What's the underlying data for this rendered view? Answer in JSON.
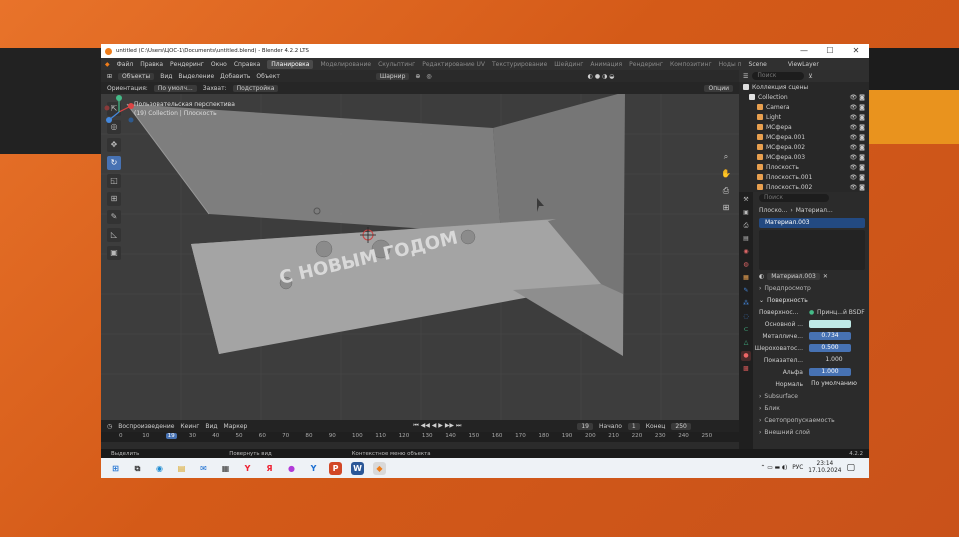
{
  "window": {
    "title": "untitled (C:\\Users\\ЦОС-1\\Documents\\untitled.blend) - Blender 4.2.2 LTS",
    "min": "—",
    "max": "☐",
    "close": "✕"
  },
  "menu": {
    "items": [
      "Файл",
      "Правка",
      "Рендеринг",
      "Окно",
      "Справка"
    ],
    "workspaces": [
      "Планировка",
      "Моделирование",
      "Скульптинг",
      "Редактирование UV",
      "Текстурирование",
      "Шейдинг",
      "Анимация",
      "Рендеринг",
      "Композитинг",
      "Ноды п"
    ],
    "scene": "Scene",
    "view_layer": "ViewLayer"
  },
  "header": {
    "mode": "Объекты",
    "view": "Вид",
    "select": "Выделение",
    "add": "Добавить",
    "object": "Объект",
    "shading": "Шарнир",
    "options": "Опции"
  },
  "header2": {
    "orientation_label": "Ориентация:",
    "orientation": "По умолч...",
    "drag_label": "Захват:",
    "snap": "Подстройка"
  },
  "viewport": {
    "perspective": "Пользовательская перспектива",
    "collection": "(19) Collection | Плоскость",
    "text3d": "С НОВЫМ ГОДОМ"
  },
  "timeline": {
    "playback": "Воспроизведение",
    "keying": "Кеинг",
    "view": "Вид",
    "marker": "Маркер",
    "current": "19",
    "start_label": "Начало",
    "start": "1",
    "end_label": "Конец",
    "end": "250",
    "ticks": [
      "0",
      "10",
      "19",
      "30",
      "40",
      "50",
      "60",
      "70",
      "80",
      "90",
      "100",
      "110",
      "120",
      "130",
      "140",
      "150",
      "160",
      "170",
      "180",
      "190",
      "200",
      "210",
      "220",
      "230",
      "240",
      "250"
    ]
  },
  "status": {
    "select": "Выделить",
    "rotate": "Повернуть вид",
    "context": "Контекстное меню объекта",
    "version": "4.2.2"
  },
  "outliner": {
    "search": "Поиск",
    "root": "Коллекция сцены",
    "rows": [
      {
        "label": "Collection",
        "color": "#e2e2e2"
      },
      {
        "label": "Camera",
        "color": "#e8a050"
      },
      {
        "label": "Light",
        "color": "#e8a050"
      },
      {
        "label": "МСфера",
        "color": "#e8a050"
      },
      {
        "label": "МСфера.001",
        "color": "#e8a050"
      },
      {
        "label": "МСфера.002",
        "color": "#e8a050"
      },
      {
        "label": "МСфера.003",
        "color": "#e8a050"
      },
      {
        "label": "Плоскость",
        "color": "#e8a050"
      },
      {
        "label": "Плоскость.001",
        "color": "#e8a050"
      },
      {
        "label": "Плоскость.002",
        "color": "#e8a050"
      }
    ]
  },
  "props": {
    "search": "Поиск",
    "object": "Плоско...",
    "material": "Материал...",
    "slot": "Материал.003",
    "mat_name": "Материал.003",
    "preview": "Предпросмотр",
    "surface_section": "Поверхность",
    "surface_label": "Поверхнос...",
    "surface_value": "Принц...й BSDF",
    "fields": [
      {
        "label": "Основной ...",
        "value": "",
        "kind": "color"
      },
      {
        "label": "Металличе...",
        "value": "0.734",
        "kind": "num"
      },
      {
        "label": "Шероховатос...",
        "value": "0.500",
        "kind": "num"
      },
      {
        "label": "Показател...",
        "value": "1.000",
        "kind": "plain"
      },
      {
        "label": "Альфа",
        "value": "1.000",
        "kind": "num"
      },
      {
        "label": "Нормаль",
        "value": "По умолчанию",
        "kind": "plain"
      }
    ],
    "sections": [
      "Subsurface",
      "Блик",
      "Светопропускаемость",
      "Внешний слой"
    ]
  },
  "taskbar": {
    "lang": "РУС",
    "time": "23:14",
    "date": "17.10.2024"
  },
  "colors": {
    "accent": "#4772b3",
    "blender": "#ef7d1a"
  }
}
